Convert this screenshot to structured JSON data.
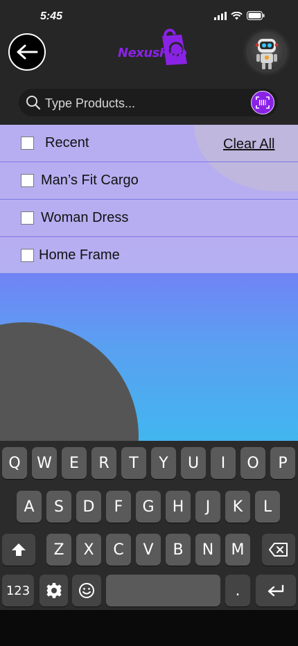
{
  "status": {
    "time": "5:45"
  },
  "header": {
    "logo_text": "NexusHub",
    "back_icon": "arrow-left-icon",
    "avatar_icon": "robot-avatar-icon"
  },
  "search": {
    "placeholder": "Type Products...",
    "value": "",
    "scan_icon": "barcode-scan-icon"
  },
  "recent": {
    "label": "Recent",
    "clear_label": "Clear All",
    "items": [
      {
        "label": "Man’s Fit Cargo"
      },
      {
        "label": "Woman Dress"
      },
      {
        "label": "Home Frame"
      }
    ]
  },
  "keyboard": {
    "row1": [
      "Q",
      "W",
      "E",
      "R",
      "T",
      "Y",
      "U",
      "I",
      "O",
      "P"
    ],
    "row2": [
      "A",
      "S",
      "D",
      "F",
      "G",
      "H",
      "J",
      "K",
      "L"
    ],
    "row3": [
      "Z",
      "X",
      "C",
      "V",
      "B",
      "N",
      "M"
    ],
    "numbers_label": "123",
    "period_label": ".",
    "shift_icon": "shift-icon",
    "backspace_icon": "backspace-icon",
    "settings_icon": "gear-icon",
    "emoji_icon": "emoji-icon",
    "return_icon": "return-icon"
  },
  "colors": {
    "accent": "#8a22e6",
    "list_bg": "#c8bef0",
    "gradient_top": "#7a78f7",
    "gradient_bottom": "#42b6ef"
  }
}
